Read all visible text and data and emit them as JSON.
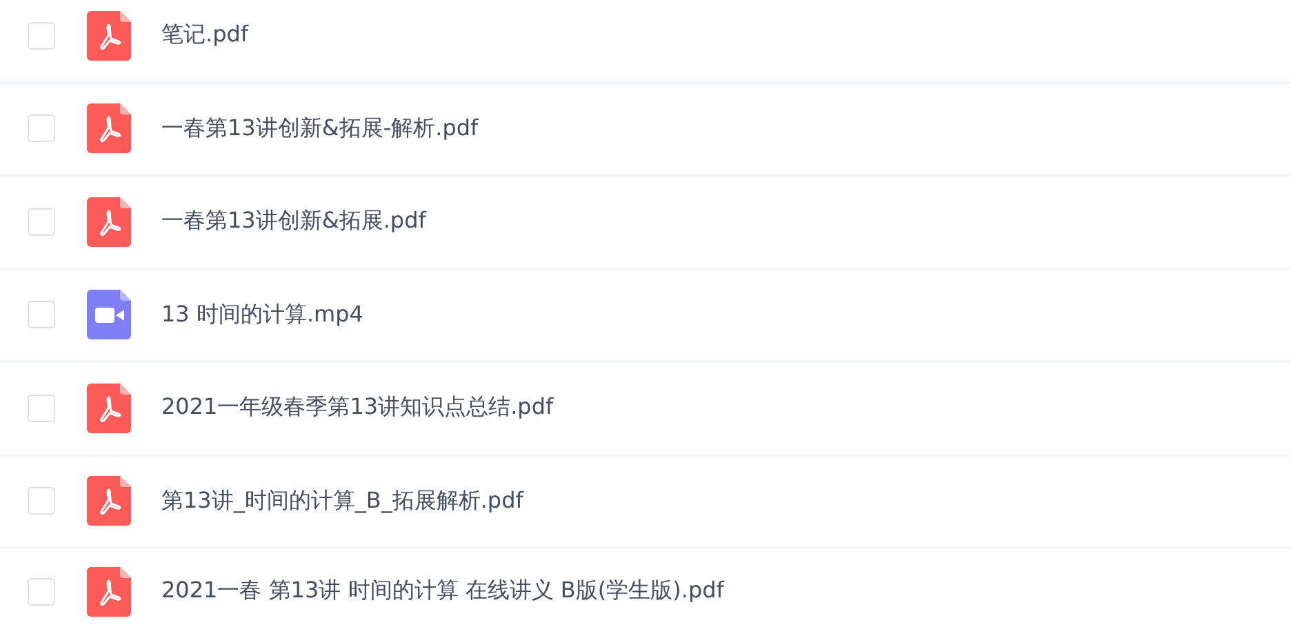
{
  "files": [
    {
      "name": "笔记.pdf",
      "kind": "pdf",
      "checked": false
    },
    {
      "name": "一春第13讲创新&拓展-解析.pdf",
      "kind": "pdf",
      "checked": false
    },
    {
      "name": "一春第13讲创新&拓展.pdf",
      "kind": "pdf",
      "checked": false
    },
    {
      "name": "13 时间的计算.mp4",
      "kind": "video",
      "checked": false
    },
    {
      "name": "2021一年级春季第13讲知识点总结.pdf",
      "kind": "pdf",
      "checked": false
    },
    {
      "name": "第13讲_时间的计算_B_拓展解析.pdf",
      "kind": "pdf",
      "checked": false
    },
    {
      "name": "2021一春 第13讲 时间的计算 在线讲义 B版(学生版).pdf",
      "kind": "pdf",
      "checked": false
    }
  ]
}
